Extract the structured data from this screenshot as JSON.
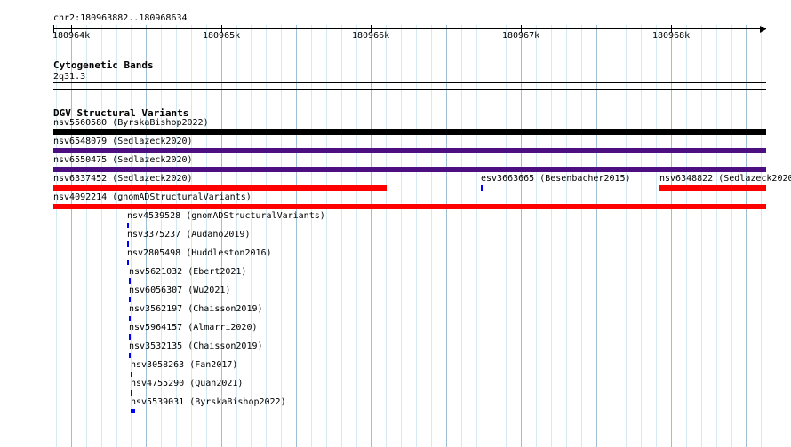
{
  "region": {
    "label": "chr2:180963882..180968634",
    "start": 180963882,
    "end": 180968634
  },
  "ruler": {
    "ticks": [
      {
        "pos": 180964000,
        "label": "180964k"
      },
      {
        "pos": 180965000,
        "label": "180965k"
      },
      {
        "pos": 180966000,
        "label": "180966k"
      },
      {
        "pos": 180967000,
        "label": "180967k"
      },
      {
        "pos": 180968000,
        "label": "180968k"
      }
    ]
  },
  "cytoband_track": {
    "title": "Cytogenetic Bands",
    "band": "2q31.3"
  },
  "dgv_track": {
    "title": "DGV Structural Variants",
    "colors": {
      "black": "#000000",
      "purple": "#4b0f82",
      "red": "#ff0000",
      "blue": "#0000ff"
    },
    "features": [
      {
        "label": "nsv5560580 (ByrskaBishop2022)",
        "start": 180963882,
        "end": 180968634,
        "color": "black"
      },
      {
        "label": "nsv6548079 (Sedlazeck2020)",
        "start": 180963882,
        "end": 180968634,
        "color": "purple"
      },
      {
        "label": "nsv6550475 (Sedlazeck2020)",
        "start": 180963882,
        "end": 180968634,
        "color": "purple"
      },
      {
        "label": "nsv6337452 (Sedlazeck2020)",
        "start": 180963882,
        "end": 180966102,
        "color": "red"
      },
      {
        "label": "esv3663665 (Besenbacher2015)",
        "start": 180966733,
        "end": 180966745,
        "color": "blue"
      },
      {
        "label": "nsv6348822 (Sedlazeck2020)",
        "start": 180967925,
        "end": 180968634,
        "color": "red"
      },
      {
        "label": "nsv4092214 (gnomADStructuralVariants)",
        "start": 180963882,
        "end": 180968634,
        "color": "red"
      },
      {
        "label": "nsv4539528 (gnomADStructuralVariants)",
        "start": 180964376,
        "end": 180964388,
        "color": "blue"
      },
      {
        "label": "nsv3375237 (Audano2019)",
        "start": 180964376,
        "end": 180964388,
        "color": "blue"
      },
      {
        "label": "nsv2805498 (Huddleston2016)",
        "start": 180964376,
        "end": 180964388,
        "color": "blue"
      },
      {
        "label": "nsv5621032 (Ebert2021)",
        "start": 180964388,
        "end": 180964400,
        "color": "blue"
      },
      {
        "label": "nsv6056307 (Wu2021)",
        "start": 180964388,
        "end": 180964400,
        "color": "blue"
      },
      {
        "label": "nsv3562197 (Chaisson2019)",
        "start": 180964388,
        "end": 180964400,
        "color": "blue"
      },
      {
        "label": "nsv5964157 (Almarri2020)",
        "start": 180964388,
        "end": 180964400,
        "color": "blue"
      },
      {
        "label": "nsv3532135 (Chaisson2019)",
        "start": 180964388,
        "end": 180964400,
        "color": "blue"
      },
      {
        "label": "nsv3058263 (Fan2017)",
        "start": 180964400,
        "end": 180964412,
        "color": "blue"
      },
      {
        "label": "nsv4755290 (Quan2021)",
        "start": 180964400,
        "end": 180964412,
        "color": "blue"
      },
      {
        "label": "nsv5539031 (ByrskaBishop2022)",
        "start": 180964400,
        "end": 180964430,
        "color": "blue"
      }
    ]
  }
}
